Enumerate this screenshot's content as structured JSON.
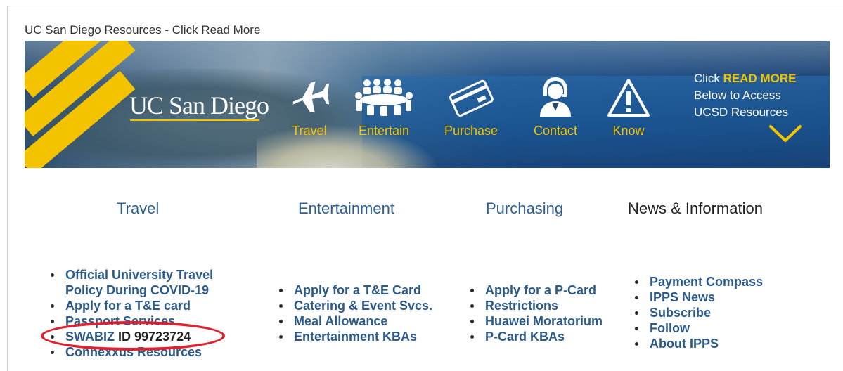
{
  "section_title": "UC San Diego Resources - Click Read More",
  "banner": {
    "logo": "UC San Diego",
    "nav": [
      {
        "label": "Travel",
        "icon": "airplane-icon"
      },
      {
        "label": "Entertain",
        "icon": "conference-table-icon"
      },
      {
        "label": "Purchase",
        "icon": "credit-card-icon"
      },
      {
        "label": "Contact",
        "icon": "support-agent-icon"
      },
      {
        "label": "Know",
        "icon": "warning-triangle-icon"
      }
    ],
    "cta": {
      "line1_prefix": "Click ",
      "line1_highlight": "READ MORE",
      "line2": "Below to Access",
      "line3": "UCSD Resources",
      "icon": "chevron-down-icon"
    },
    "colors": {
      "accent": "#f3c300",
      "navy": "#1b4a82"
    }
  },
  "columns": {
    "travel": {
      "title": "Travel",
      "items": [
        {
          "label": "Official University Travel Policy During COVID-19"
        },
        {
          "label": "Apply for a T&E card"
        },
        {
          "label": "Passport Services"
        },
        {
          "label": "SWABIZ",
          "suffix": " ID 99723724"
        },
        {
          "label": "Connexxus Resources"
        }
      ]
    },
    "entertainment": {
      "title": "Entertainment",
      "items": [
        {
          "label": "Apply for a T&E Card"
        },
        {
          "label": "Catering & Event Svcs."
        },
        {
          "label": "Meal Allowance"
        },
        {
          "label": "Entertainment KBAs"
        }
      ]
    },
    "purchasing": {
      "title": "Purchasing",
      "items": [
        {
          "label": "Apply for a P-Card"
        },
        {
          "label": "Restrictions"
        },
        {
          "label": "Huawei Moratorium"
        },
        {
          "label": "P-Card KBAs"
        }
      ]
    },
    "news": {
      "title": "News & Information",
      "items": [
        {
          "label": "Payment Compass"
        },
        {
          "label": "IPPS News"
        },
        {
          "label": "Subscribe"
        },
        {
          "label": "Follow"
        },
        {
          "label": "About IPPS"
        }
      ]
    }
  },
  "annotation": {
    "color": "#e0212e"
  }
}
